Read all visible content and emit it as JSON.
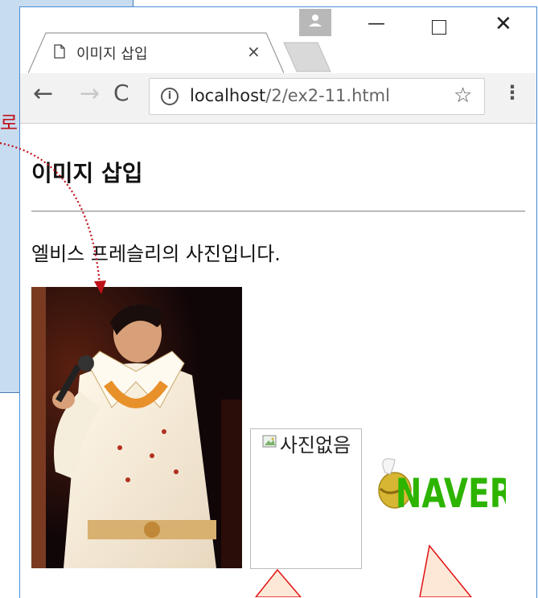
{
  "annotation": {
    "label": "로 출력"
  },
  "browser": {
    "tab": {
      "title": "이미지 삽입",
      "close_glyph": "×"
    },
    "window_controls": {
      "minimize": "—",
      "close": "✕"
    },
    "toolbar": {
      "back": "←",
      "forward": "→",
      "reload": "C",
      "info": "i",
      "url_host": "localhost",
      "url_path": "/2/ex2-11.html",
      "star": "☆",
      "menu": "⋮"
    }
  },
  "page": {
    "heading": "이미지 삽입",
    "paragraph": "엘비스 프레슬리의 사진입니다.",
    "broken_image_alt": "사진없음",
    "logo_text": "NAVER"
  },
  "colors": {
    "annotation_red": "#c0101a",
    "naver_green": "#2db400",
    "panel_blue": "#c8dcf0"
  }
}
